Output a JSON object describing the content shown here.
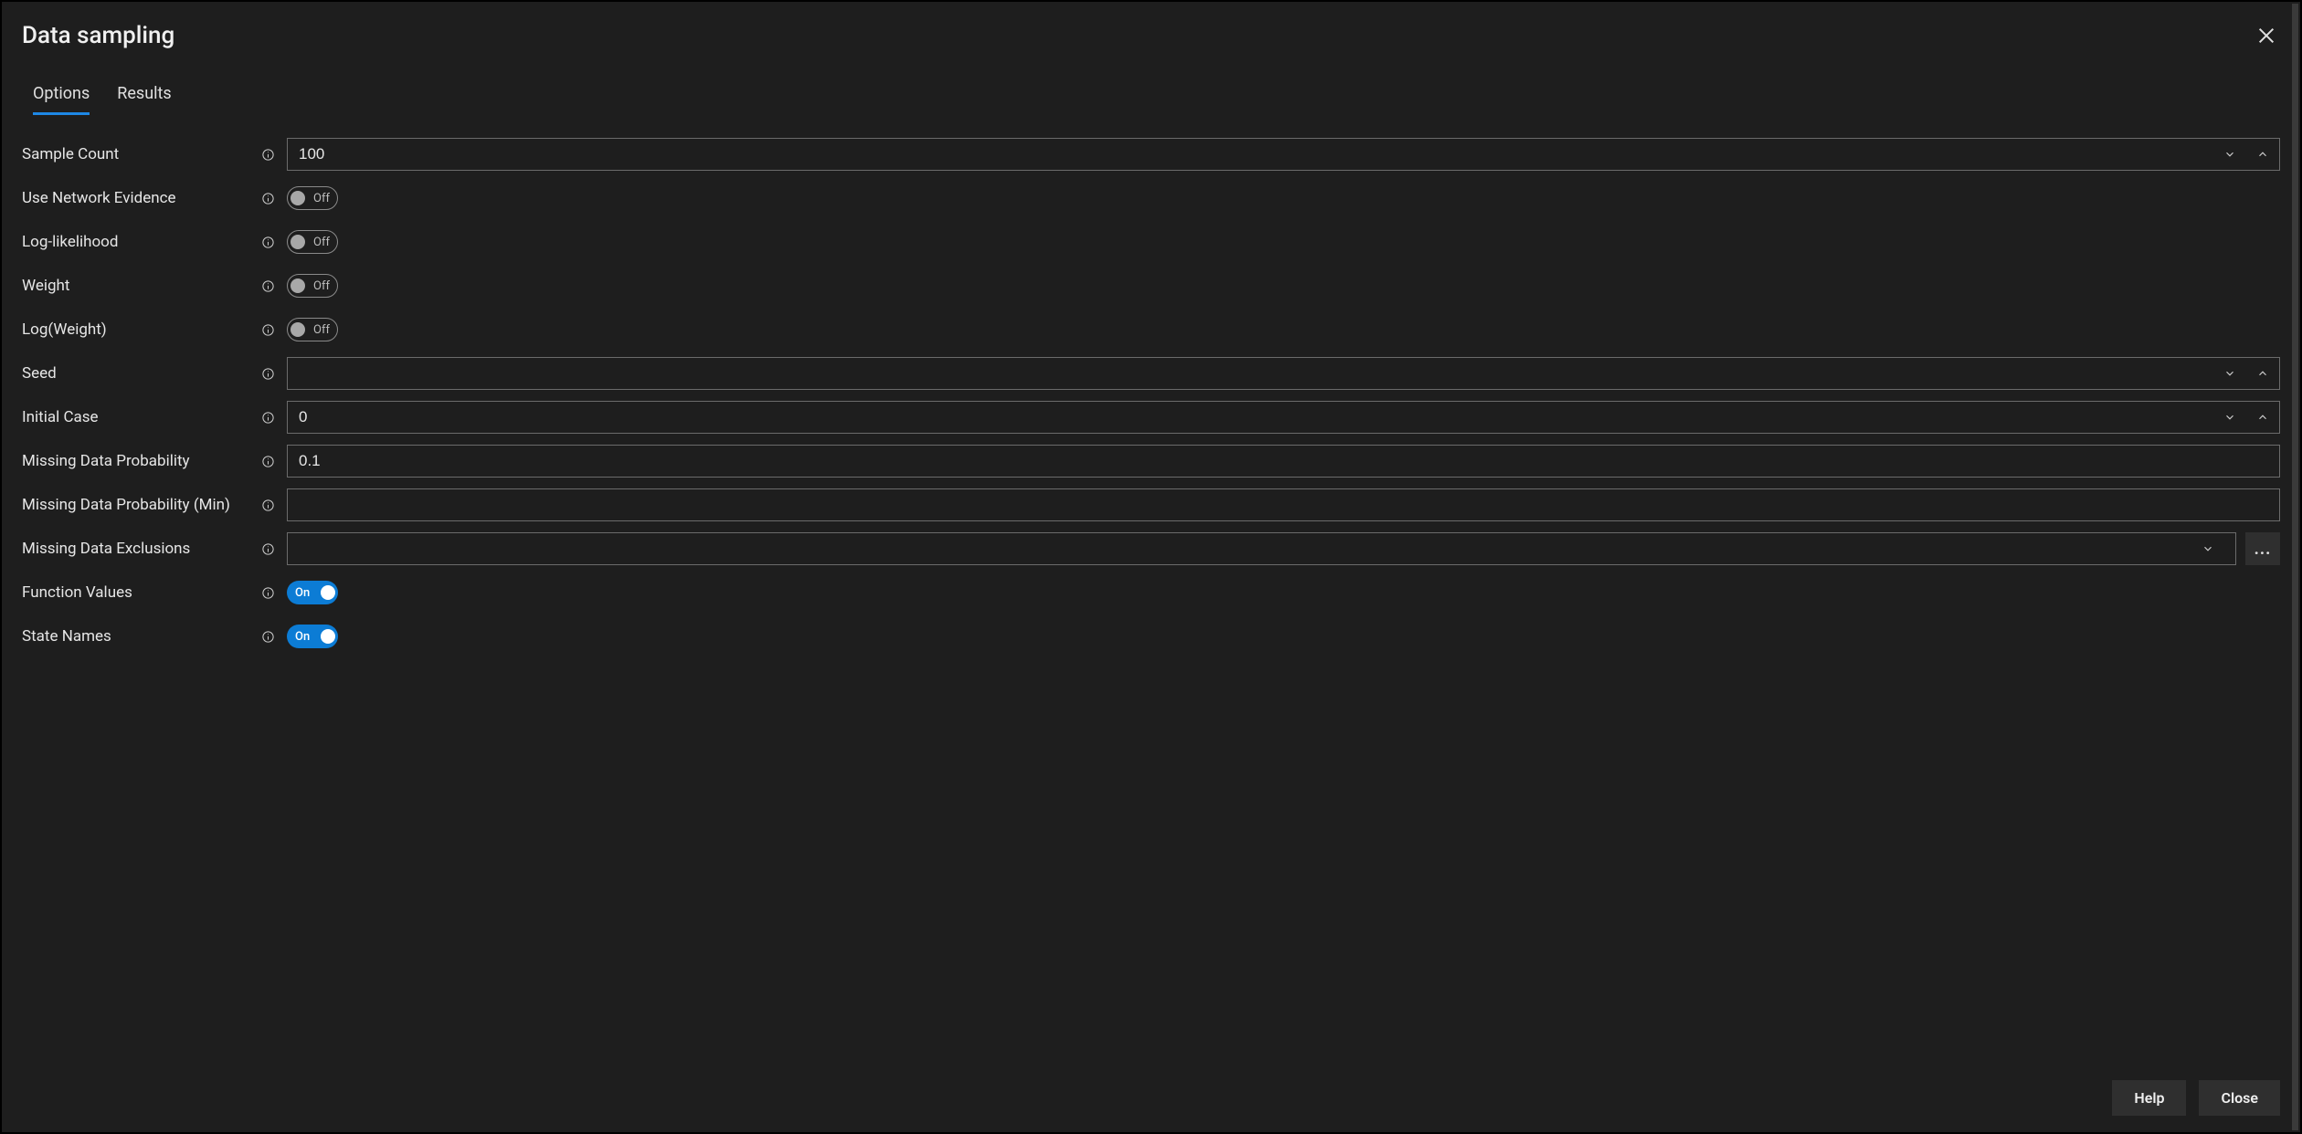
{
  "dialog": {
    "title": "Data sampling"
  },
  "tabs": {
    "options_label": "Options",
    "results_label": "Results",
    "active": "options"
  },
  "toggle_labels": {
    "on": "On",
    "off": "Off"
  },
  "fields": {
    "sample_count": {
      "label": "Sample Count",
      "value": "100"
    },
    "use_net_evidence": {
      "label": "Use Network Evidence",
      "value": "off"
    },
    "log_likelihood": {
      "label": "Log-likelihood",
      "value": "off"
    },
    "weight": {
      "label": "Weight",
      "value": "off"
    },
    "log_weight": {
      "label": "Log(Weight)",
      "value": "off"
    },
    "seed": {
      "label": "Seed",
      "value": ""
    },
    "initial_case": {
      "label": "Initial Case",
      "value": "0"
    },
    "missing_prob": {
      "label": "Missing Data Probability",
      "value": "0.1"
    },
    "missing_prob_min": {
      "label": "Missing Data Probability (Min)",
      "value": ""
    },
    "missing_exclusions": {
      "label": "Missing Data Exclusions",
      "value": ""
    },
    "function_values": {
      "label": "Function Values",
      "value": "on"
    },
    "state_names": {
      "label": "State Names",
      "value": "on"
    }
  },
  "footer": {
    "help_label": "Help",
    "close_label": "Close"
  },
  "ellipsis": "..."
}
